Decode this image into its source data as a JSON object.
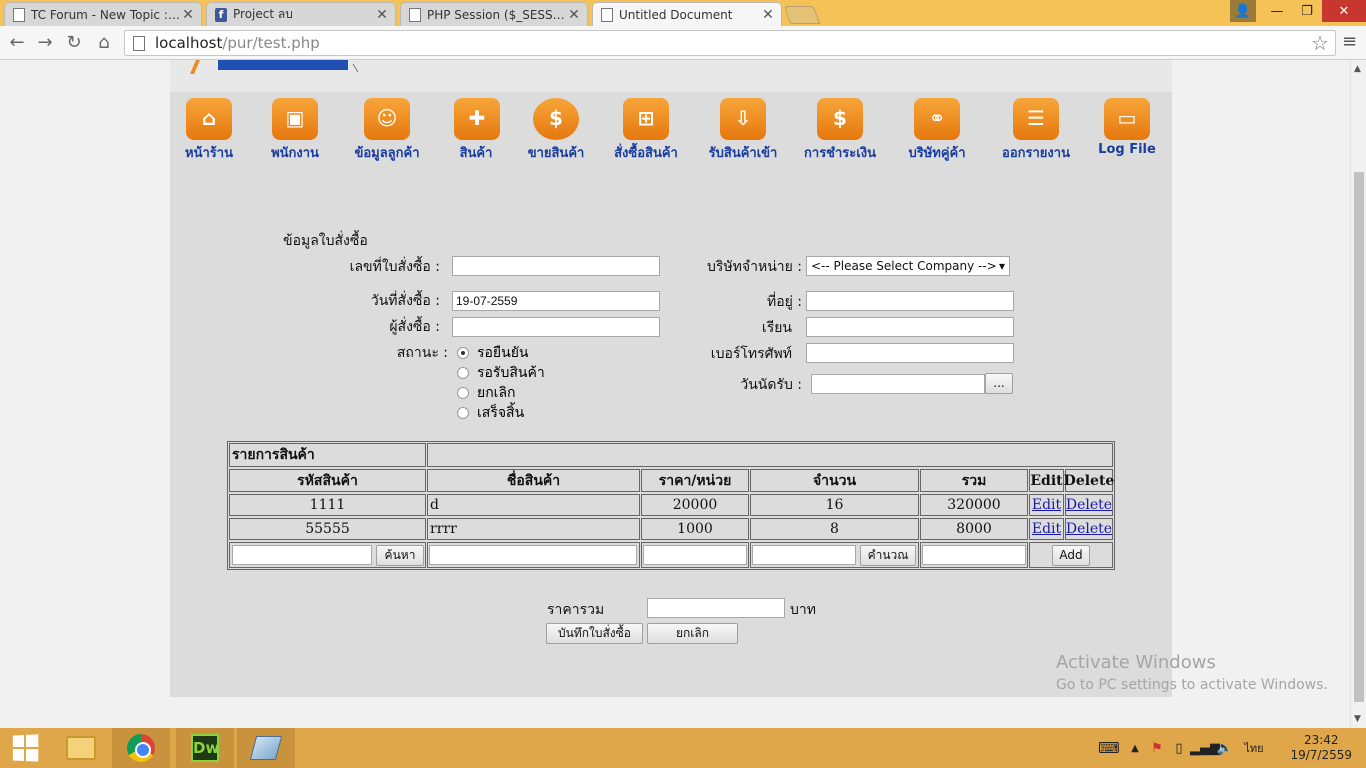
{
  "browser": {
    "tabs": [
      {
        "title": "TC Forum - New Topic :: #",
        "icon": "document-icon"
      },
      {
        "title": "Project ลบ",
        "icon": "facebook-icon"
      },
      {
        "title": "PHP Session ($_SESSION,$",
        "icon": "document-icon"
      },
      {
        "title": "Untitled Document",
        "icon": "document-icon",
        "active": true
      }
    ],
    "url_host": "localhost",
    "url_path": "/pur/test.php"
  },
  "nav": [
    {
      "label": "หน้าร้าน",
      "icon": "shop-icon"
    },
    {
      "label": "พนักงาน",
      "icon": "briefcase-icon"
    },
    {
      "label": "ข้อมูลลูกค้า",
      "icon": "id-card-icon"
    },
    {
      "label": "สินค้า",
      "icon": "gift-icon"
    },
    {
      "label": "ขายสินค้า",
      "icon": "coin-icon"
    },
    {
      "label": "สั่งซื้อสินค้า",
      "icon": "basket-icon"
    },
    {
      "label": "รับสินค้าเข้า",
      "icon": "box-icon"
    },
    {
      "label": "การชำระเงิน",
      "icon": "payment-icon"
    },
    {
      "label": "บริษัทคู่ค้า",
      "icon": "handshake-icon"
    },
    {
      "label": "ออกรายงาน",
      "icon": "report-icon"
    },
    {
      "label": "Log File",
      "icon": "folder-icon"
    }
  ],
  "form": {
    "section_title": "ข้อมูลใบสั่งซื้อ",
    "order_no_label": "เลขที่ใบสั่งซื้อ :",
    "order_no_value": "",
    "order_date_label": "วันที่สั่งซื้อ :",
    "order_date_value": "19-07-2559",
    "orderer_label": "ผู้สั่งซื้อ :",
    "orderer_value": "",
    "status_label": "สถานะ :",
    "status_options": [
      "รอยืนยัน",
      "รอรับสินค้า",
      "ยกเลิก",
      "เสร็จสิ้น"
    ],
    "status_selected": "รอยืนยัน",
    "company_label": "บริษัทจำหน่าย :",
    "company_value": "<-- Please Select Company -->",
    "address_label": "ที่อยู่ :",
    "address_value": "",
    "attn_label": "เรียน",
    "attn_value": "",
    "phone_label": "เบอร์โทรศัพท์",
    "phone_value": "",
    "appt_label": "วันนัดรับ :",
    "appt_value": "",
    "appt_btn": "..."
  },
  "table": {
    "caption": "รายการสินค้า",
    "headers": [
      "รหัสสินค้า",
      "ชื่อสินค้า",
      "ราคา/หน่วย",
      "จำนวน",
      "รวม",
      "Edit",
      "Delete"
    ],
    "rows": [
      {
        "code": "1111",
        "name": "d",
        "price": "20000",
        "qty": "16",
        "total": "320000",
        "edit": "Edit",
        "delete": "Delete"
      },
      {
        "code": "55555",
        "name": "rrrr",
        "price": "1000",
        "qty": "8",
        "total": "8000",
        "edit": "Edit",
        "delete": "Delete"
      }
    ],
    "search_btn": "ค้นหา",
    "calc_btn": "คำนวณ",
    "add_btn": "Add"
  },
  "summary": {
    "total_label": "ราคารวม",
    "total_value": "",
    "unit": "บาท",
    "save_btn": "บันทึกใบสั่งซื้อ",
    "cancel_btn": "ยกเลิก"
  },
  "watermark": {
    "line1": "Activate Windows",
    "line2": "Go to PC settings to activate Windows."
  },
  "taskbar": {
    "lang": "ไทย",
    "time": "23:42",
    "date": "19/7/2559"
  }
}
